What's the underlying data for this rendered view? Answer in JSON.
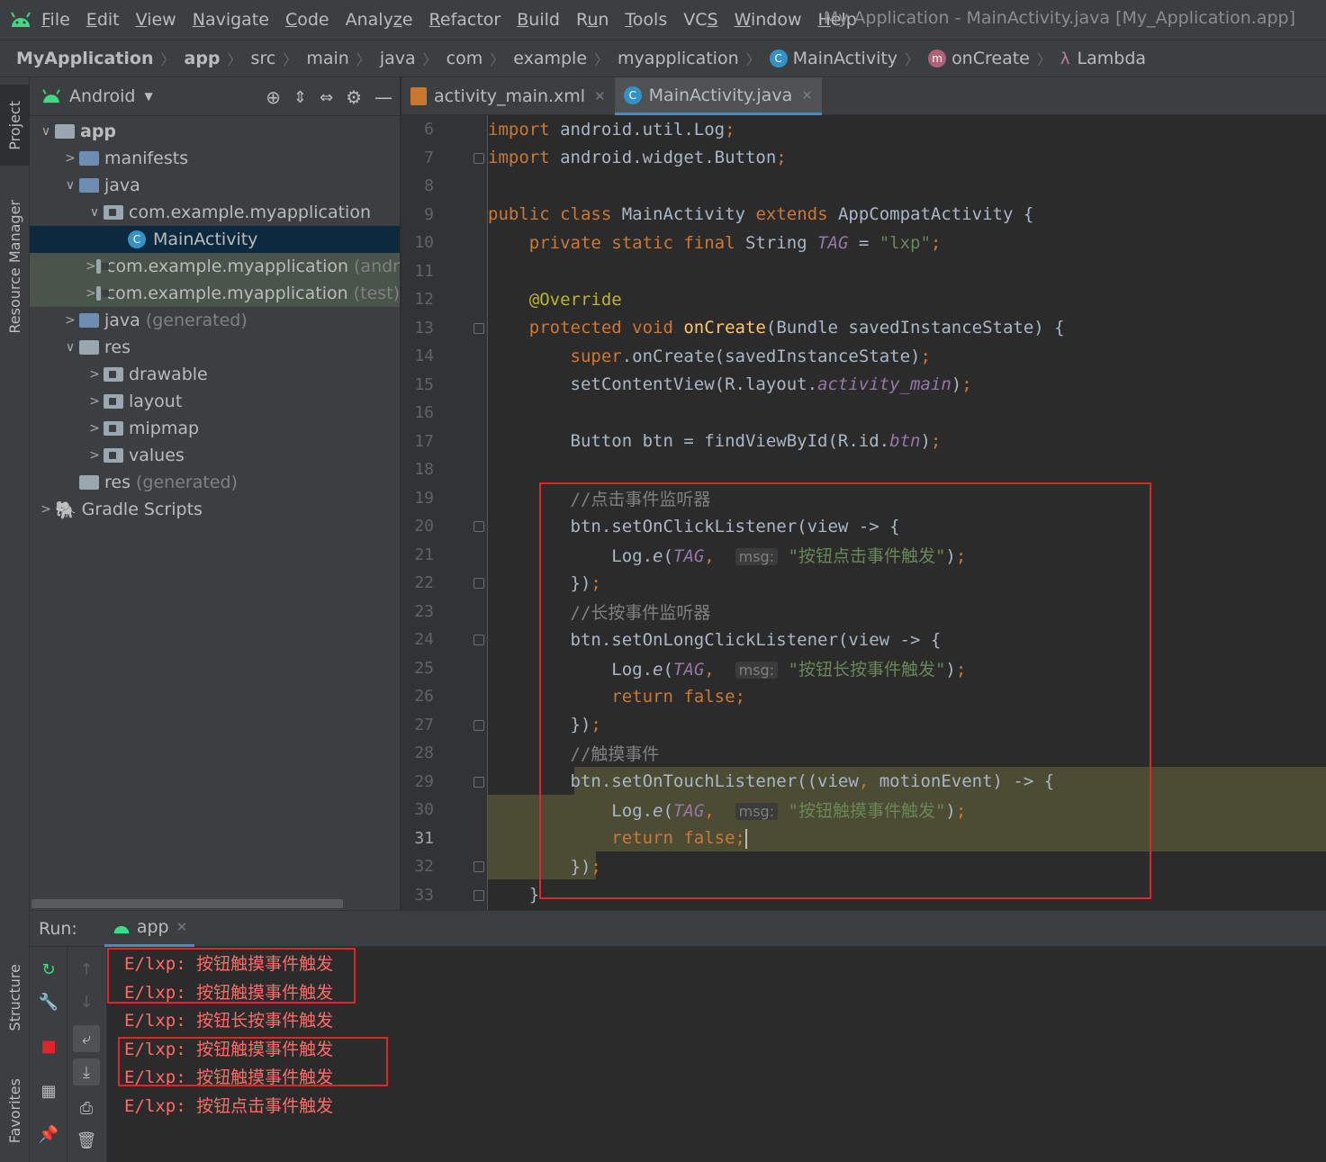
{
  "menubar": {
    "items": [
      {
        "pre": "",
        "u": "F",
        "post": "ile"
      },
      {
        "pre": "",
        "u": "E",
        "post": "dit"
      },
      {
        "pre": "",
        "u": "V",
        "post": "iew"
      },
      {
        "pre": "",
        "u": "N",
        "post": "avigate"
      },
      {
        "pre": "",
        "u": "C",
        "post": "ode"
      },
      {
        "pre": "Analy",
        "u": "z",
        "post": "e"
      },
      {
        "pre": "",
        "u": "R",
        "post": "efactor"
      },
      {
        "pre": "",
        "u": "B",
        "post": "uild"
      },
      {
        "pre": "R",
        "u": "u",
        "post": "n"
      },
      {
        "pre": "",
        "u": "T",
        "post": "ools"
      },
      {
        "pre": "VC",
        "u": "S",
        "post": ""
      },
      {
        "pre": "",
        "u": "W",
        "post": "indow"
      },
      {
        "pre": "",
        "u": "H",
        "post": "elp"
      }
    ],
    "window_title": "My Application - MainActivity.java [My_Application.app]"
  },
  "breadcrumb": [
    "MyApplication",
    "app",
    "src",
    "main",
    "java",
    "com",
    "example",
    "myapplication",
    "MainActivity",
    "onCreate",
    "Lambda"
  ],
  "left_strip": {
    "project": "Project",
    "resource_manager": "Resource Manager",
    "structure": "Structure",
    "favorites": "Favorites"
  },
  "project_panel": {
    "view": "Android",
    "tree": [
      {
        "label": "app",
        "muted": ""
      },
      {
        "label": "manifests",
        "muted": ""
      },
      {
        "label": "java",
        "muted": ""
      },
      {
        "label": "com.example.myapplication",
        "muted": ""
      },
      {
        "label": "MainActivity",
        "muted": ""
      },
      {
        "label": "com.example.myapplication",
        "muted": "(andr"
      },
      {
        "label": "com.example.myapplication",
        "muted": "(test)"
      },
      {
        "label": "java",
        "muted": "(generated)"
      },
      {
        "label": "res",
        "muted": ""
      },
      {
        "label": "drawable",
        "muted": ""
      },
      {
        "label": "layout",
        "muted": ""
      },
      {
        "label": "mipmap",
        "muted": ""
      },
      {
        "label": "values",
        "muted": ""
      },
      {
        "label": "res",
        "muted": "(generated)"
      },
      {
        "label": "Gradle Scripts",
        "muted": ""
      }
    ]
  },
  "editor_tabs": [
    "activity_main.xml",
    "MainActivity.java"
  ],
  "editor": {
    "line_numbers": [
      "6",
      "7",
      "8",
      "9",
      "10",
      "11",
      "12",
      "13",
      "14",
      "15",
      "16",
      "17",
      "18",
      "19",
      "20",
      "21",
      "22",
      "23",
      "24",
      "25",
      "26",
      "27",
      "28",
      "29",
      "30",
      "31",
      "32",
      "33"
    ],
    "hint_label": "msg:",
    "comments": [
      "//点击事件监听器",
      "//长按事件监听器",
      "//触摸事件"
    ],
    "strings": [
      "\"lxp\"",
      "\"按钮点击事件触发\"",
      "\"按钮长按事件触发\"",
      "\"按钮触摸事件触发\""
    ]
  },
  "run_panel": {
    "label": "Run:",
    "tab": "app",
    "log": [
      "E/lxp: 按钮触摸事件触发",
      "E/lxp: 按钮触摸事件触发",
      "E/lxp: 按钮长按事件触发",
      "E/lxp: 按钮触摸事件触发",
      "E/lxp: 按钮触摸事件触发",
      "E/lxp: 按钮点击事件触发"
    ]
  },
  "colors": {
    "background": "#2b2b2b",
    "panel": "#3c3f41",
    "keyword": "#cc7832",
    "string": "#6a8759",
    "annotation": "#bbb529",
    "log_error": "#ff6b68",
    "highlight_box": "#e0242a",
    "android_green": "#3ddc84"
  }
}
